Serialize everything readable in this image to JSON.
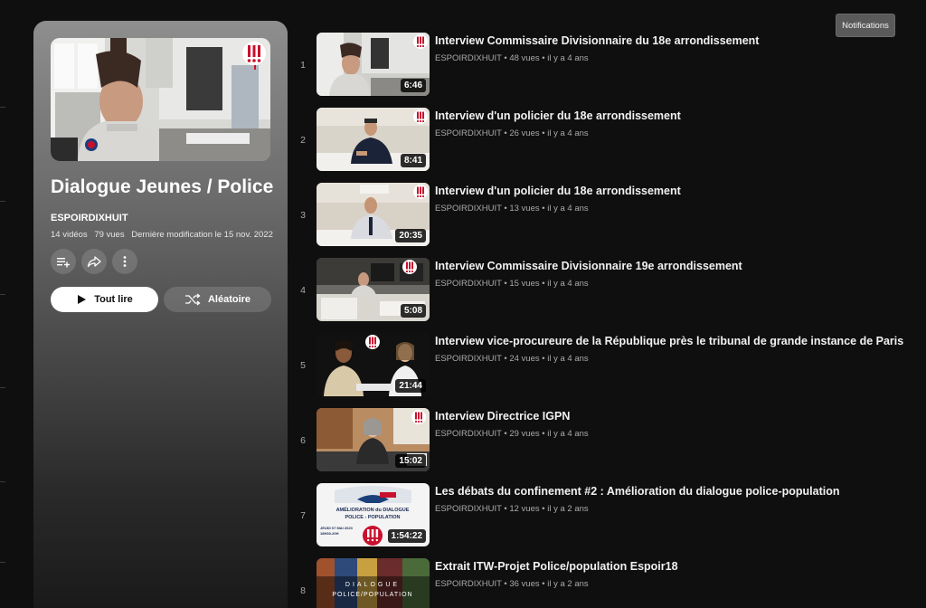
{
  "notifications_label": "Notifications",
  "playlist": {
    "title": "Dialogue Jeunes / Police",
    "owner": "ESPOIRDIXHUIT",
    "video_count": "14 vidéos",
    "views": "79 vues",
    "updated": "Dernière modification le 15 nov. 2022",
    "play_all_label": "Tout lire",
    "shuffle_label": "Aléatoire"
  },
  "videos": [
    {
      "index": "1",
      "title": "Interview Commissaire Divisionnaire du 18e arrondissement",
      "channel": "ESPOIRDIXHUIT",
      "stats": "48 vues • il y a 4 ans",
      "duration": "6:46"
    },
    {
      "index": "2",
      "title": "Interview d'un policier du 18e arrondissement",
      "channel": "ESPOIRDIXHUIT",
      "stats": "26 vues • il y a 4 ans",
      "duration": "8:41"
    },
    {
      "index": "3",
      "title": "Interview d'un policier du 18e arrondissement",
      "channel": "ESPOIRDIXHUIT",
      "stats": "13 vues • il y a 4 ans",
      "duration": "20:35"
    },
    {
      "index": "4",
      "title": "Interview Commissaire Divisionnaire 19e arrondissement",
      "channel": "ESPOIRDIXHUIT",
      "stats": "15 vues • il y a 4 ans",
      "duration": "5:08"
    },
    {
      "index": "5",
      "title": "Interview vice-procureure de la République près le tribunal de grande instance de Paris",
      "channel": "ESPOIRDIXHUIT",
      "stats": "24 vues • il y a 4 ans",
      "duration": "21:44"
    },
    {
      "index": "6",
      "title": "Interview Directrice IGPN",
      "channel": "ESPOIRDIXHUIT",
      "stats": "29 vues • il y a 4 ans",
      "duration": "15:02"
    },
    {
      "index": "7",
      "title": "Les débats du confinement #2 : Amélioration du dialogue police-population",
      "channel": "ESPOIRDIXHUIT",
      "stats": "12 vues • il y a 2 ans",
      "duration": "1:54:22"
    },
    {
      "index": "8",
      "title": "Extrait ITW-Projet Police/population Espoir18",
      "channel": "ESPOIRDIXHUIT",
      "stats": "36 vues • il y a 2 ans",
      "duration": ""
    }
  ],
  "thumb_texts": {
    "t7_line1": "AMÉLIORATION du DIALOGUE",
    "t7_line2": "POLICE - POPULATION",
    "t7_date": "JEUDI 07 MAI 2020",
    "t7_time": "18H30-20H",
    "t8_line1": "DIALOGUE",
    "t8_line2": "POLICE/POPULATION"
  },
  "colors": {
    "accent": "#c8102e",
    "background": "#0f0f0f"
  }
}
